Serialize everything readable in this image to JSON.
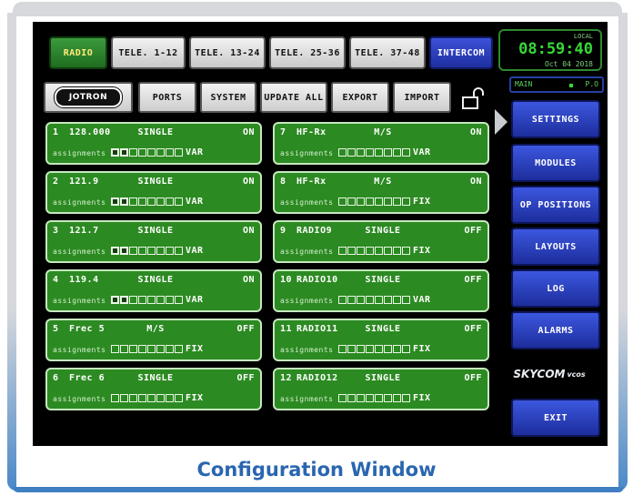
{
  "tabs": [
    {
      "label": "RADIO",
      "active": true
    },
    {
      "label": "TELE. 1-12"
    },
    {
      "label": "TELE. 13-24"
    },
    {
      "label": "TELE. 25-36"
    },
    {
      "label": "TELE. 37-48"
    },
    {
      "label": "INTERCOM"
    }
  ],
  "toolbar": {
    "logo": "JOTRON",
    "ports": "PORTS",
    "system": "SYSTEM",
    "update_all": "UPDATE ALL",
    "export": "EXPORT",
    "import": "IMPORT",
    "lock_icon": "padlock-open-icon"
  },
  "clock": {
    "local_label": "LOCAL",
    "time": "08:59:40",
    "date": "Oct 04 2018"
  },
  "position": {
    "main": "MAIN",
    "po": "P.O"
  },
  "side_buttons": [
    "SETTINGS",
    "MODULES",
    "OP POSITIONS",
    "LAYOUTS",
    "LOG",
    "ALARMS"
  ],
  "exit_label": "EXIT",
  "brand": {
    "name": "SKYCOM",
    "suffix": "vcos"
  },
  "channels": [
    {
      "num": "1",
      "freq": "128.000",
      "mode": "SINGLE",
      "state": "ON",
      "assign": "assignments",
      "tail": "VAR",
      "active_squares": 2
    },
    {
      "num": "2",
      "freq": "121.9",
      "mode": "SINGLE",
      "state": "ON",
      "assign": "assignments",
      "tail": "VAR",
      "active_squares": 2
    },
    {
      "num": "3",
      "freq": "121.7",
      "mode": "SINGLE",
      "state": "ON",
      "assign": "assignments",
      "tail": "VAR",
      "active_squares": 2
    },
    {
      "num": "4",
      "freq": "119.4",
      "mode": "SINGLE",
      "state": "ON",
      "assign": "assignments",
      "tail": "VAR",
      "active_squares": 2
    },
    {
      "num": "5",
      "freq": "Frec 5",
      "mode": "M/S",
      "state": "OFF",
      "assign": "assignments",
      "tail": "FIX",
      "active_squares": 0
    },
    {
      "num": "6",
      "freq": "Frec 6",
      "mode": "SINGLE",
      "state": "OFF",
      "assign": "assignments",
      "tail": "FIX",
      "active_squares": 0
    },
    {
      "num": "7",
      "freq": "HF-Rx",
      "mode": "M/S",
      "state": "ON",
      "assign": "assignments",
      "tail": "VAR",
      "active_squares": 0
    },
    {
      "num": "8",
      "freq": "HF-Rx",
      "mode": "M/S",
      "state": "ON",
      "assign": "assignments",
      "tail": "FIX",
      "active_squares": 0
    },
    {
      "num": "9",
      "freq": "RADIO9",
      "mode": "SINGLE",
      "state": "OFF",
      "assign": "assignments",
      "tail": "FIX",
      "active_squares": 0
    },
    {
      "num": "10",
      "freq": "RADIO10",
      "mode": "SINGLE",
      "state": "OFF",
      "assign": "assignments",
      "tail": "VAR",
      "active_squares": 0
    },
    {
      "num": "11",
      "freq": "RADIO11",
      "mode": "SINGLE",
      "state": "OFF",
      "assign": "assignments",
      "tail": "FIX",
      "active_squares": 0
    },
    {
      "num": "12",
      "freq": "RADIO12",
      "mode": "SINGLE",
      "state": "OFF",
      "assign": "assignments",
      "tail": "FIX",
      "active_squares": 0
    }
  ],
  "caption": "Configuration Window"
}
